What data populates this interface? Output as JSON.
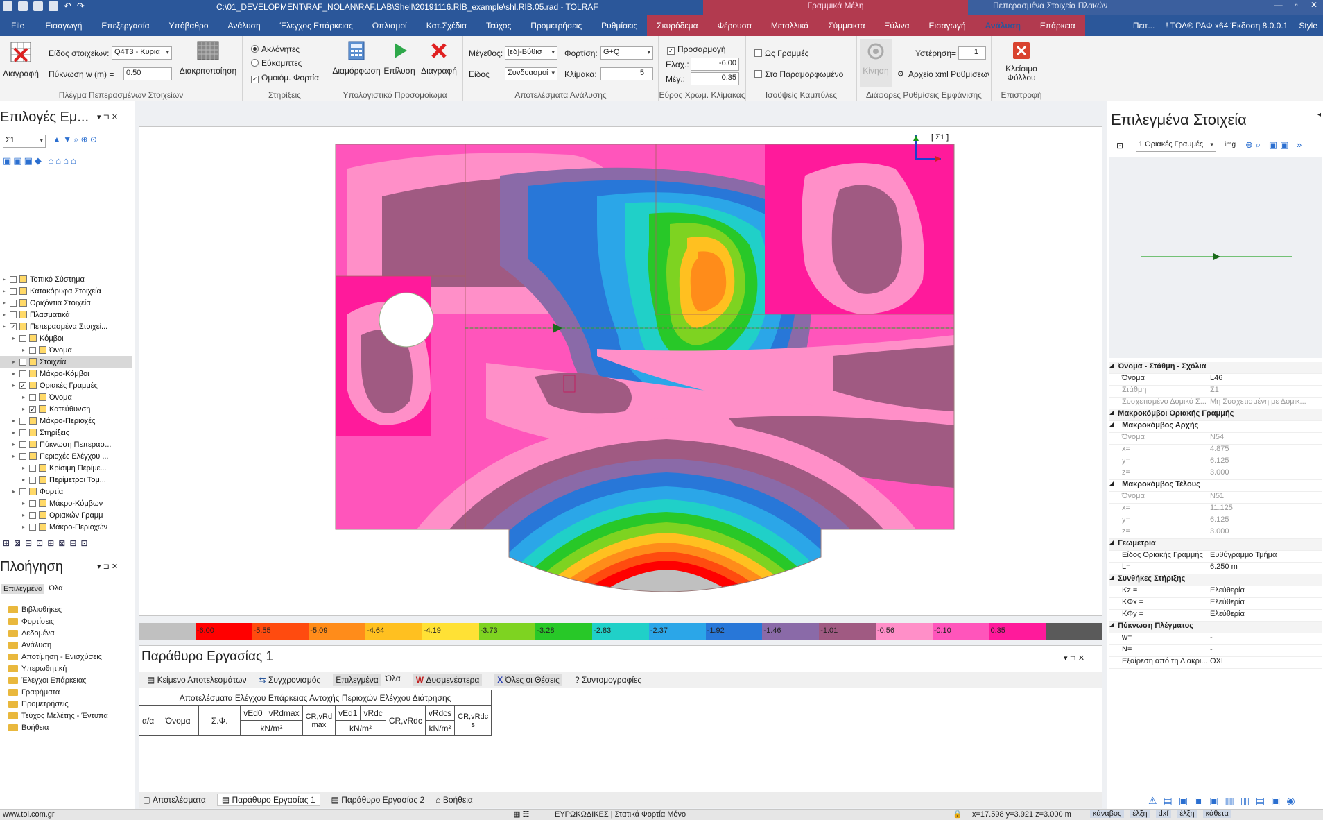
{
  "titlebar": {
    "path": "C:\\01_DEVELOPMENT\\RAF_NOLAN\\RAF.LAB\\Shell\\20191116.RIB_example\\shl.RIB.05.rad - TOLRAF",
    "context1": "Γραμμικά Μέλη",
    "context2": "Πεπερασμένα Στοιχεία Πλακών"
  },
  "tabs": [
    "File",
    "Εισαγωγή",
    "Επεξεργασία",
    "Υπόβαθρο",
    "Ανάλυση",
    "Έλεγχος Επάρκειας",
    "Οπλισμοί",
    "Κατ.Σχέδια",
    "Τεύχος",
    "Προμετρήσεις",
    "Ρυθμίσεις",
    "Σκυρόδεμα",
    "Φέρουσα",
    "Μεταλλικά",
    "Σύμμεικτα",
    "Ξύλινα",
    "Εισαγωγή",
    "Ανάλυση",
    "Επάρκεια"
  ],
  "tabs_right": {
    "search": "Πειτ...",
    "version": "! ΤΟΛ® ΡΑΦ x64 Έκδοση 8.0.0.1",
    "style": "Style"
  },
  "ribbon": {
    "g1": {
      "label": "Πλέγμα Πεπερασμένων Στοιχείων",
      "delete": "Διαγραφή",
      "type_label": "Είδος στοιχείων:",
      "type_value": "Q4T3 - Κυρια",
      "density_label": "Πύκνωση w (m) =",
      "density_value": "0.50",
      "discretize": "Διακριτοποίηση"
    },
    "g2": {
      "label": "Στηρίξεις",
      "r1": "Ακλόνητες",
      "r2": "Εύκαμπτες",
      "c1": "Ομοιόμ. Φορτία"
    },
    "g3": {
      "label": "Υπολογιστικό Προσομοίωμα",
      "b1": "Διαμόρφωση",
      "b2": "Επίλυση",
      "b3": "Διαγραφή"
    },
    "g4": {
      "label": "Αποτελέσματα Ανάλυσης",
      "size_label": "Μέγεθος:",
      "size_value": "[εδ]-Βύθισ",
      "kind_label": "Είδος",
      "kind_value": "Συνδυασμοί",
      "load_label": "Φορτίση:",
      "load_value": "G+Q",
      "scale_label": "Κλίμακα:",
      "scale_value": "5"
    },
    "g5": {
      "label": "Εύρος Χρωμ. Κλίμακας",
      "fit": "Προσαρμογή",
      "min_label": "Ελαχ.:",
      "min_value": "-6.00",
      "max_label": "Μέγ.:",
      "max_value": "0.35"
    },
    "g6": {
      "label": "Ισοϋψείς Καμπύλες",
      "c1": "Ως Γραμμές",
      "c2": "Στο Παραμορφωμένο"
    },
    "g7": {
      "label": "Διάφορες Ρυθμίσεις Εμφάνισης",
      "motion": "Κίνηση",
      "lag_label": "Υστέρηση=",
      "lag_value": "1",
      "xml": "Αρχείο xml Ρυθμίσεων ..."
    },
    "g8": {
      "label": "Επιστροφή",
      "close": "Κλείσιμο Φύλλου"
    }
  },
  "left": {
    "title": "Επιλογές Εμ...",
    "combo": "Σ1",
    "tree": [
      {
        "t": "Τοπικό Σύστημα",
        "d": 0,
        "c": false
      },
      {
        "t": "Κατακόρυφα Στοιχεία",
        "d": 0,
        "c": false
      },
      {
        "t": "Οριζόντια Στοιχεία",
        "d": 0,
        "c": false
      },
      {
        "t": "Πλασματικά",
        "d": 0,
        "c": false
      },
      {
        "t": "Πεπερασμένα Στοιχεί...",
        "d": 0,
        "c": true
      },
      {
        "t": "Κόμβοι",
        "d": 1,
        "c": false
      },
      {
        "t": "Όνομα",
        "d": 2,
        "c": false
      },
      {
        "t": "Στοιχεία",
        "d": 1,
        "c": false
      },
      {
        "t": "Μάκρο-Κόμβοι",
        "d": 1,
        "c": false
      },
      {
        "t": "Οριακές Γραμμές",
        "d": 1,
        "c": true
      },
      {
        "t": "Όνομα",
        "d": 2,
        "c": false
      },
      {
        "t": "Κατεύθυνση",
        "d": 2,
        "c": true
      },
      {
        "t": "Μάκρο-Περιοχές",
        "d": 1,
        "c": false
      },
      {
        "t": "Στηρίξεις",
        "d": 1,
        "c": false
      },
      {
        "t": "Πύκνωση Πεπερασ...",
        "d": 1,
        "c": false
      },
      {
        "t": "Περιοχές Ελέγχου ...",
        "d": 1,
        "c": false
      },
      {
        "t": "Κρίσιμη Περίμε...",
        "d": 2,
        "c": false
      },
      {
        "t": "Περίμετροι Τομ...",
        "d": 2,
        "c": false
      },
      {
        "t": "Φορτία",
        "d": 1,
        "c": false
      },
      {
        "t": "Μάκρο-Κόμβων",
        "d": 2,
        "c": false
      },
      {
        "t": "Οριακών Γραμμ",
        "d": 2,
        "c": false
      },
      {
        "t": "Μάκρο-Περιοχών",
        "d": 2,
        "c": false
      }
    ],
    "nav_title": "Πλοήγηση",
    "nav_tabs": [
      "Επιλεγμένα",
      "Όλα"
    ],
    "nav_items": [
      "Βιβλιοθήκες",
      "Φορτίσεις",
      "Δεδομένα",
      "Ανάλυση",
      "Αποτίμηση - Ενισχύσεις",
      "Υπερωθητική",
      "Έλεγχοι Επάρκειας",
      "Γραφήματα",
      "Προμετρήσεις",
      "Τεύχος Μελέτης - Έντυπα",
      "Βοήθεια"
    ]
  },
  "canvas": {
    "view_label": "[ Σ1 ]"
  },
  "legend": {
    "values": [
      "",
      "-6.00",
      "-5.55",
      "-5.09",
      "-4.64",
      "-4.19",
      "-3.73",
      "-3.28",
      "-2.83",
      "-2.37",
      "-1.92",
      "-1.46",
      "-1.01",
      "-0.56",
      "-0.10",
      "0.35"
    ],
    "colors": [
      "#c0c0c0",
      "#ff0000",
      "#ff4b0f",
      "#ff8c1a",
      "#ffc020",
      "#ffe135",
      "#7ed321",
      "#28c828",
      "#20d0c8",
      "#2ba6e8",
      "#2877d8",
      "#8a6aa8",
      "#a05a82",
      "#ff8fc8",
      "#ff55bb",
      "#ff1a9b",
      "#5a5a5a"
    ]
  },
  "work": {
    "title": "Παράθυρο Εργασίας 1",
    "toolbar": [
      "Κείμενο Αποτελεσμάτων",
      "Συγχρονισμός",
      "Επιλεγμένα",
      "Όλα",
      "Δυσμενέστερα",
      "Όλες οι Θέσεις",
      "Συντομογραφίες"
    ],
    "table_title": "Αποτελέσματα Ελέγχου Επάρκειας Αντοχής Περιοχών Ελέγχου Διάτρησης",
    "cols": [
      "α/α",
      "Όνομα",
      "Σ.Φ.",
      "vEd0",
      "vRdmax",
      "CR,vRd max",
      "vEd1",
      "vRdc",
      "CR,vRdc",
      "vRdcs",
      "CR,vRdc s"
    ],
    "unit": "kN/m²",
    "bottom_tabs": [
      "Αποτελέσματα",
      "Παράθυρο Εργασίας 1",
      "Παράθυρο Εργασίας 2",
      "Βοήθεια"
    ]
  },
  "right": {
    "title": "Επιλεγμένα Στοιχεία",
    "combo": "1 Οριακές Γραμμές",
    "img_btn": "img",
    "props": [
      {
        "type": "sec",
        "k": "Όνομα - Στάθμη - Σχόλια"
      },
      {
        "k": "Όνομα",
        "v": "L46"
      },
      {
        "k": "Στάθμη",
        "v": "Σ1",
        "grey": true
      },
      {
        "k": "Συσχετισμένο Δομικό Σ...",
        "v": "Μη Συσχετισμένη με Δομικ...",
        "grey": true
      },
      {
        "type": "sec",
        "k": "Μακροκόμβοι Οριακής Γραμμής"
      },
      {
        "type": "sub",
        "k": "Μακροκόμβος Αρχής"
      },
      {
        "k": "Όνομα",
        "v": "N54",
        "grey": true
      },
      {
        "k": "x=",
        "v": "4.875",
        "grey": true
      },
      {
        "k": "y=",
        "v": "6.125",
        "grey": true
      },
      {
        "k": "z=",
        "v": "3.000",
        "grey": true
      },
      {
        "type": "sub",
        "k": "Μακροκόμβος Τέλους"
      },
      {
        "k": "Όνομα",
        "v": "N51",
        "grey": true
      },
      {
        "k": "x=",
        "v": "11.125",
        "grey": true
      },
      {
        "k": "y=",
        "v": "6.125",
        "grey": true
      },
      {
        "k": "z=",
        "v": "3.000",
        "grey": true
      },
      {
        "type": "sec",
        "k": "Γεωμετρία"
      },
      {
        "k": "Είδος Οριακής Γραμμής",
        "v": "Ευθύγραμμο Τμήμα"
      },
      {
        "k": "L=",
        "v": "6.250 m"
      },
      {
        "type": "sec",
        "k": "Συνθήκες Στήριξης"
      },
      {
        "k": "Kz =",
        "v": "Ελεύθερία"
      },
      {
        "k": "KΦx =",
        "v": "Ελεύθερία"
      },
      {
        "k": "KΦy =",
        "v": "Ελεύθερία"
      },
      {
        "type": "sec",
        "k": "Πύκνωση Πλέγματος"
      },
      {
        "k": "w=",
        "v": "-"
      },
      {
        "k": "N=",
        "v": "-"
      },
      {
        "k": "Εξαίρεση από τη Διακρι...",
        "v": "ΟΧΙ"
      }
    ]
  },
  "status": {
    "url": "www.tol.com.gr",
    "codes": "ΕΥΡΩΚΩΔΙΚΕΣ | Στατικά Φορτία Μόνο",
    "coords": "x=17.598 y=3.921 z=3.000 m",
    "modes": [
      "κάναβος",
      "έλξη",
      "dxf",
      "έλξη",
      "κάθετα"
    ]
  }
}
